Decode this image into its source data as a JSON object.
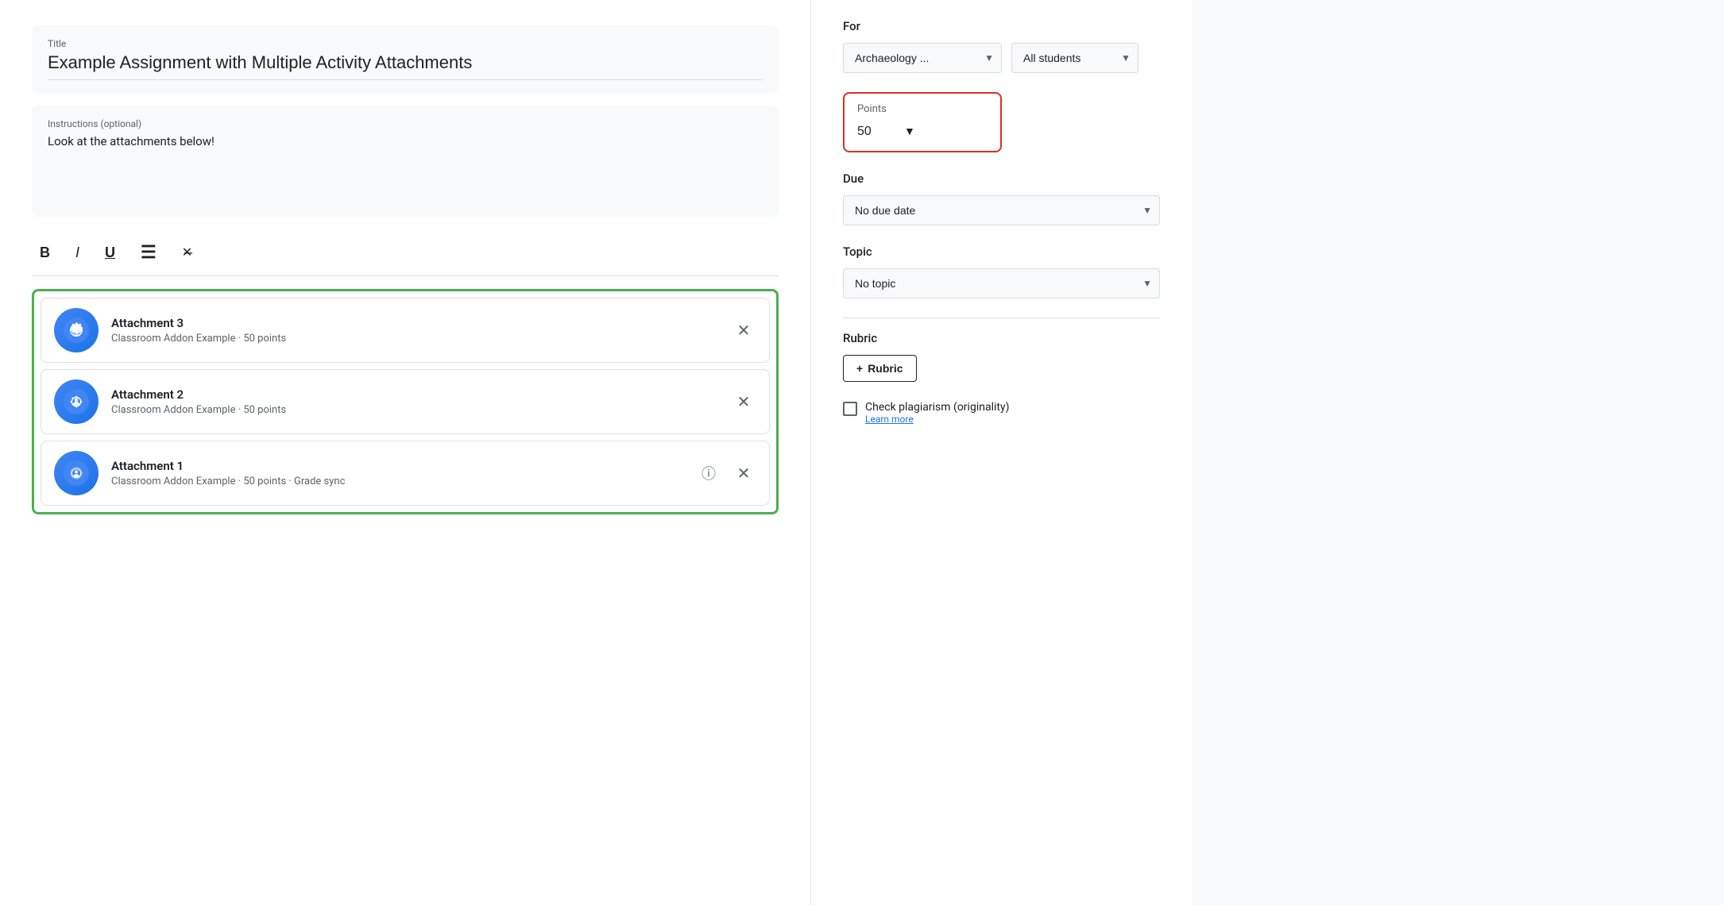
{
  "title_field": {
    "label": "Title",
    "value": "Example Assignment with Multiple Activity Attachments"
  },
  "instructions_field": {
    "label": "Instructions (optional)",
    "value": "Look at the attachments below!"
  },
  "toolbar": {
    "bold": "B",
    "italic": "I",
    "underline": "U",
    "list": "≡",
    "clear": "✕"
  },
  "attachments": [
    {
      "id": "attachment-3",
      "title": "Attachment 3",
      "subtitle": "Classroom Addon Example · 50 points",
      "has_info": false
    },
    {
      "id": "attachment-2",
      "title": "Attachment 2",
      "subtitle": "Classroom Addon Example · 50 points",
      "has_info": false
    },
    {
      "id": "attachment-1",
      "title": "Attachment 1",
      "subtitle": "Classroom Addon Example · 50 points · Grade sync",
      "has_info": true
    }
  ],
  "right_panel": {
    "for_label": "For",
    "class_dropdown": {
      "value": "Archaeology ...",
      "options": [
        "Archaeology ..."
      ]
    },
    "students_dropdown": {
      "value": "All students",
      "options": [
        "All students"
      ]
    },
    "points_label": "Points",
    "points_value": "50",
    "due_label": "Due",
    "due_dropdown": {
      "value": "No due date",
      "options": [
        "No due date"
      ]
    },
    "topic_label": "Topic",
    "topic_dropdown": {
      "value": "No topic",
      "options": [
        "No topic"
      ]
    },
    "rubric_label": "Rubric",
    "rubric_button": "+ Rubric",
    "plagiarism_label": "Check plagiarism (originality)",
    "learn_more": "Learn more"
  }
}
